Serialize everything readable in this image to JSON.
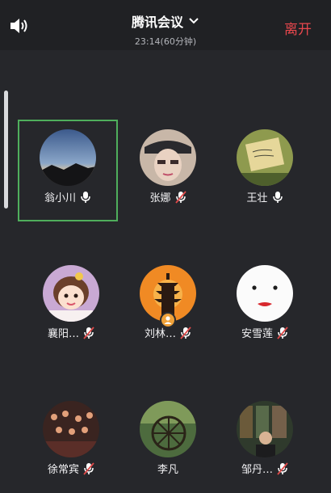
{
  "header": {
    "title": "腾讯会议",
    "subtitle": "23:14(60分钟)",
    "leave_label": "离开"
  },
  "icons": {
    "speaker": "speaker-icon",
    "dropdown": "chevron-down-icon",
    "mic_on": "microphone-icon",
    "mic_off": "microphone-muted-icon",
    "host": "host-badge-icon"
  },
  "colors": {
    "accent_leave": "#e8474d",
    "active_speaker_border": "#4fae5c",
    "mic_muted": "#e04a4a"
  },
  "participants": [
    {
      "name": "翁小川",
      "mic": "on",
      "active": true
    },
    {
      "name": "张娜",
      "mic": "muted",
      "active": false
    },
    {
      "name": "王壮",
      "mic": "on",
      "active": false
    },
    {
      "name": "襄阳…",
      "mic": "muted",
      "active": false
    },
    {
      "name": "刘林…",
      "mic": "muted",
      "active": false,
      "host": true
    },
    {
      "name": "安雪莲",
      "mic": "muted",
      "active": false
    },
    {
      "name": "徐常宾",
      "mic": "muted",
      "active": false
    },
    {
      "name": "李凡",
      "mic": "none",
      "active": false
    },
    {
      "name": "邹丹…",
      "mic": "muted",
      "active": false
    }
  ]
}
